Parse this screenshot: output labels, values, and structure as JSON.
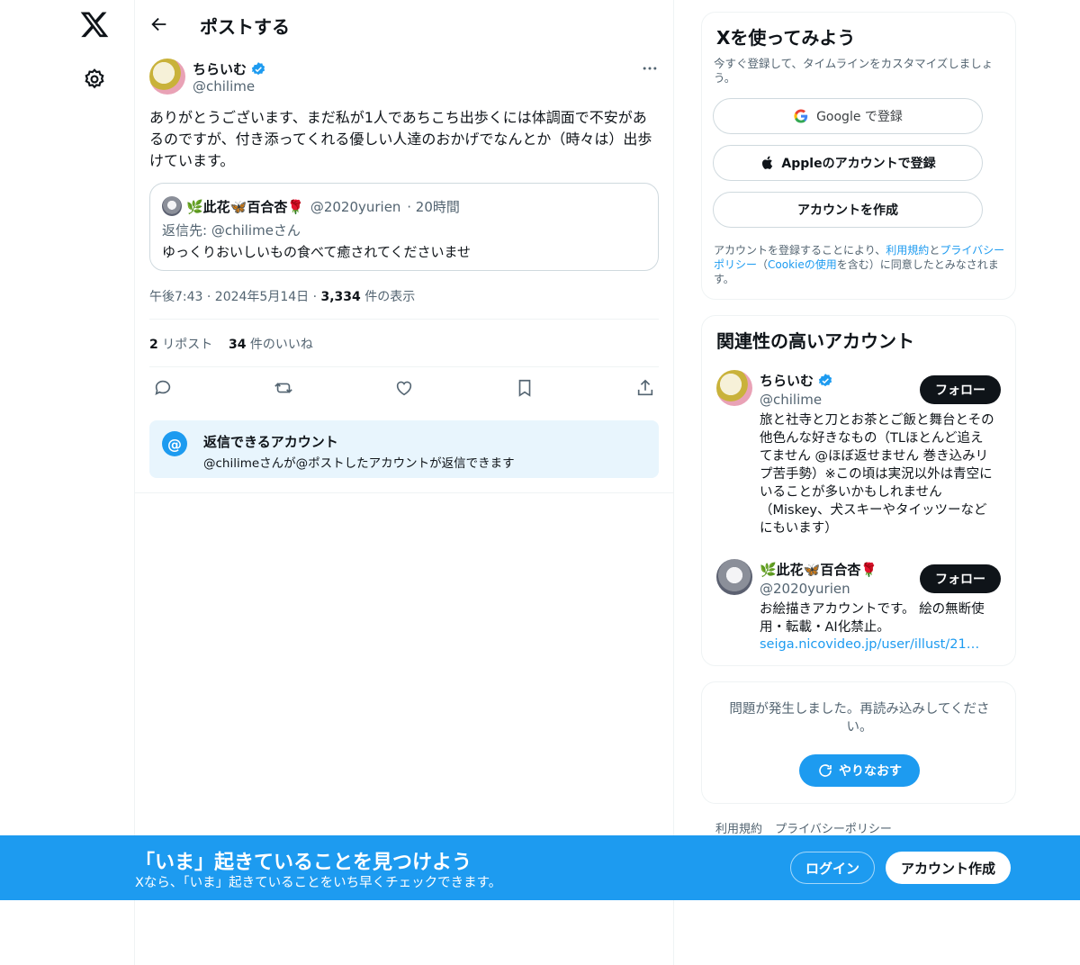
{
  "nav": {
    "logo_icon": "x-logo-icon",
    "settings_icon": "gear-icon"
  },
  "header": {
    "title": "ポストする"
  },
  "post": {
    "author_name": "ちらいむ",
    "author_handle": "@chilime",
    "text": "ありがとうございます、まだ私が1人であちこち出歩くには体調面で不安があるのですが、付き添ってくれる優しい人達のおかげでなんとか（時々は）出歩けています。",
    "quote": {
      "author_name": "🌿此花🦋百合杏🌹",
      "author_handle": "@2020yurien",
      "time": "· 20時間",
      "reply_to": "返信先: @chilimeさん",
      "text": "ゆっくりおいしいもの食べて癒されてくださいませ"
    },
    "timestamp": "午後7:43 · 2024年5月14日 · ",
    "views_count": "3,334",
    "views_label": " 件の表示",
    "reposts_count": "2",
    "reposts_label": " リポスト",
    "likes_count": "34",
    "likes_label": " 件のいいね",
    "reply_notice": {
      "title": "返信できるアカウント",
      "text": "@chilimeさんが@ポストしたアカウントが返信できます"
    }
  },
  "signup": {
    "title": "Xを使ってみよう",
    "subtitle": "今すぐ登録して、タイムラインをカスタマイズしましょう。",
    "google_label": "Google で登録",
    "apple_label": "Appleのアカウントで登録",
    "create_label": "アカウントを作成",
    "terms_1": "アカウントを登録することにより、",
    "terms_link_1": "利用規約",
    "terms_2": "と",
    "terms_link_2": "プライバシーポリシー",
    "terms_3": "（",
    "terms_link_3": "Cookieの使用",
    "terms_4": "を含む）に同意したとみなされます。"
  },
  "related": {
    "title": "関連性の高いアカウント",
    "accounts": [
      {
        "name": "ちらいむ",
        "handle": "@chilime",
        "follow": "フォロー",
        "bio": "旅と社寺と刀とお茶とご飯と舞台とその他色んな好きなもの（TLほとんど追えてません @ほぼ返せません 巻き込みリプ苦手勢）※この頃は実況以外は青空にいることが多いかもしれません（Miskey、犬スキーやタイッツーなどにもいます）"
      },
      {
        "name": "🌿此花🦋百合杏🌹",
        "handle": "@2020yurien",
        "follow": "フォロー",
        "bio": "お絵描きアカウントです。 絵の無断使用・転載・AI化禁止。",
        "link": "seiga.nicovideo.jp/user/illust/21…"
      }
    ]
  },
  "error_card": {
    "message": "問題が発生しました。再読み込みしてください。",
    "retry_label": "やりなおす"
  },
  "footer": {
    "links": [
      "利用規約",
      "プライバシーポリシー"
    ]
  },
  "banner": {
    "title": "「いま」起きていることを見つけよう",
    "subtitle": "Xなら、「いま」起きていることをいち早くチェックできます。",
    "login_label": "ログイン",
    "signup_label": "アカウント作成"
  },
  "colors": {
    "accent": "#1d9bf0",
    "text": "#0f1419",
    "muted": "#536471",
    "border": "#eff3f4"
  }
}
